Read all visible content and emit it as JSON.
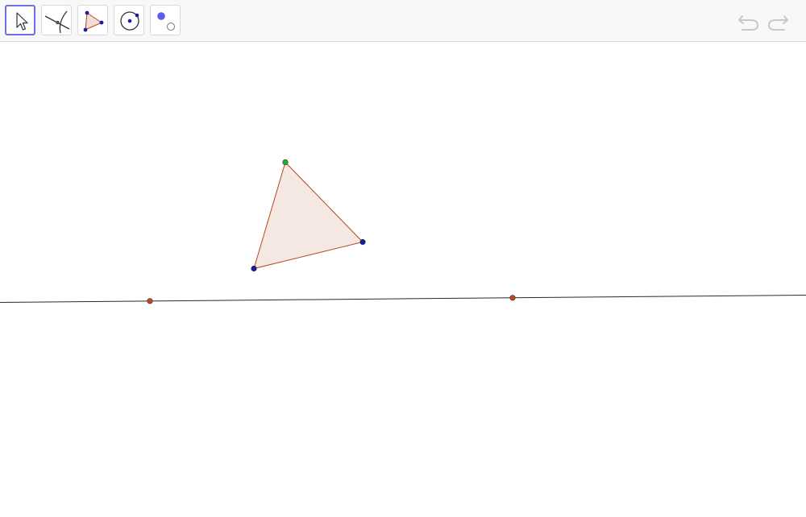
{
  "toolbar": {
    "tools": [
      {
        "name": "Move",
        "icon": "pointer-arrow-icon",
        "selected": true
      },
      {
        "name": "Intersect",
        "icon": "intersect-icon",
        "selected": false
      },
      {
        "name": "Polygon",
        "icon": "polygon-icon",
        "selected": false
      },
      {
        "name": "Circle with Center through Point",
        "icon": "circle-center-point-icon",
        "selected": false
      },
      {
        "name": "Show / Hide Object",
        "icon": "show-hide-icon",
        "selected": false
      }
    ],
    "undo": {
      "label": "Undo",
      "icon": "undo-icon",
      "enabled": false
    },
    "redo": {
      "label": "Redo",
      "icon": "redo-icon",
      "enabled": false
    }
  },
  "colors": {
    "toolbar_bg": "#f8f8f8",
    "selected_border": "#6e6ee8",
    "polygon_fill": "#f5e8e3",
    "polygon_stroke": "#b5471f",
    "free_point": "#1a1aa8",
    "special_point": "#22b422",
    "line_point": "#c0471f",
    "line_stroke": "#2b2b2b",
    "disabled_icon": "#c8c8c8"
  },
  "construction": {
    "polygon_vertices": [
      {
        "type": "special",
        "label": ""
      },
      {
        "type": "free",
        "label": ""
      },
      {
        "type": "free",
        "label": ""
      }
    ],
    "line_points": [
      {
        "label": ""
      },
      {
        "label": ""
      }
    ]
  }
}
